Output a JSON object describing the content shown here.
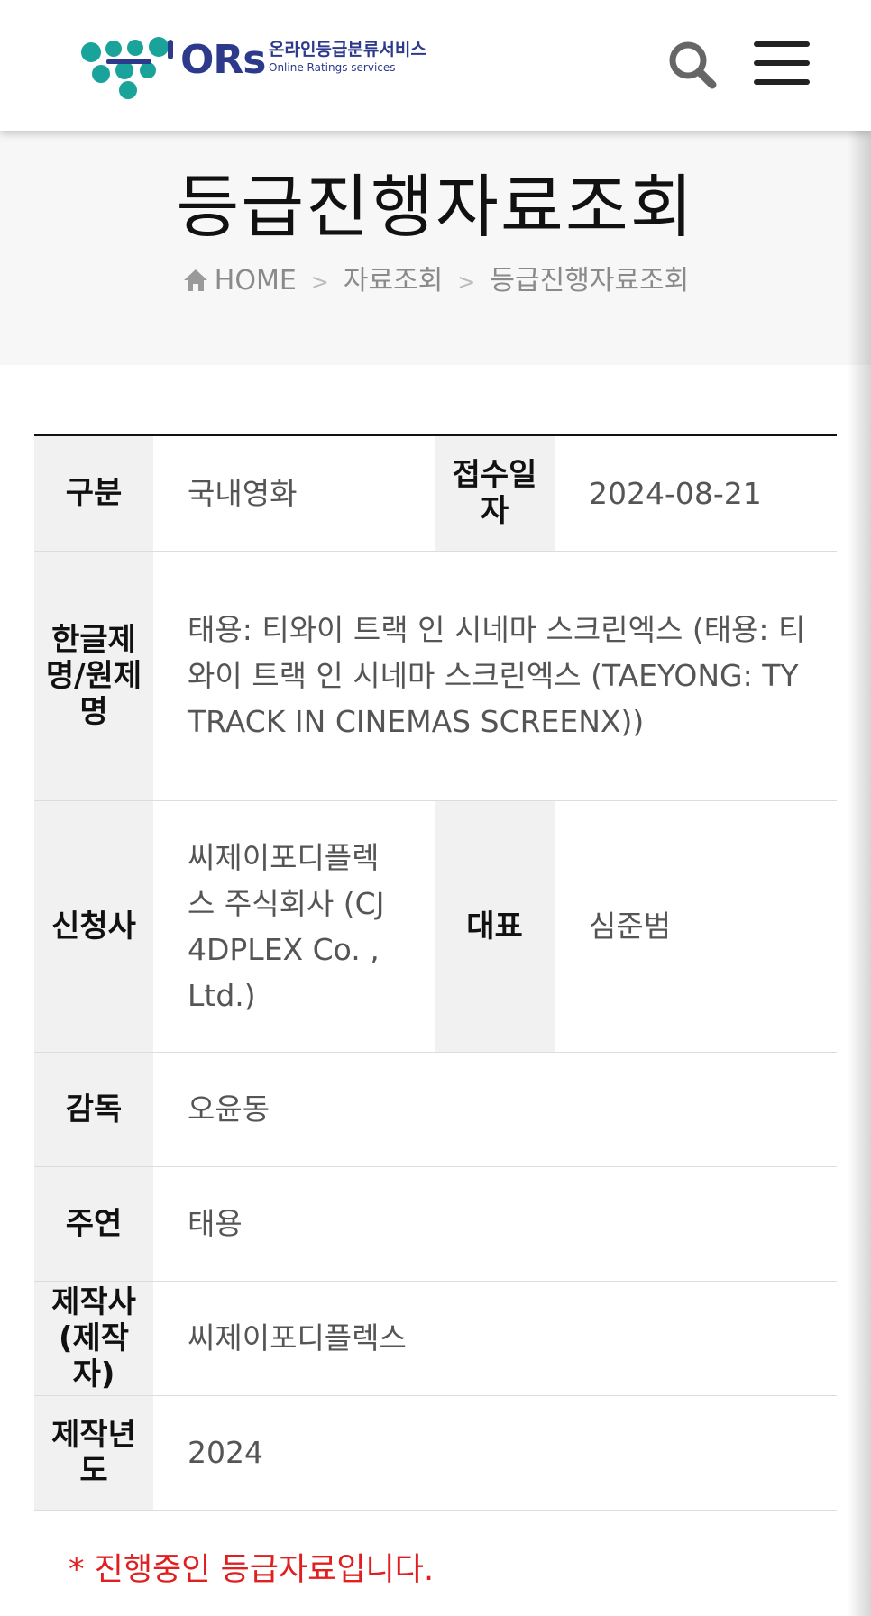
{
  "header": {
    "logo": {
      "brand": "ORs",
      "name_ko": "온라인등급분류서비스",
      "name_en": "Online Ratings services"
    },
    "icons": {
      "search": "search-icon",
      "menu": "hamburger-menu-icon"
    }
  },
  "title_band": {
    "title": "등급진행자료조회",
    "breadcrumb": [
      "HOME",
      "자료조회",
      "등급진행자료조회"
    ]
  },
  "table": {
    "rows": [
      {
        "label": "구분",
        "value": "국내영화",
        "label2": "접수일자",
        "value2": "2024-08-21"
      },
      {
        "label": "한글제명/원제명",
        "value": "태용: 티와이 트랙 인 시네마 스크린엑스 (태용: 티와이 트랙 인 시네마 스크린엑스 (TAEYONG: TY TRACK IN CINEMAS SCREENX))"
      },
      {
        "label": "신청사",
        "value": "씨제이포디플렉스 주식회사 (CJ 4DPLEX Co. , Ltd.)",
        "label2": "대표",
        "value2": "심준범"
      },
      {
        "label": "감독",
        "value": "오윤동"
      },
      {
        "label": "주연",
        "value": "태용"
      },
      {
        "label": "제작사(제작자)",
        "value": "씨제이포디플렉스"
      },
      {
        "label": "제작년도",
        "value": "2024"
      }
    ]
  },
  "notice": "* 진행중인 등급자료입니다.",
  "colors": {
    "brand_navy": "#2d3a8c",
    "brand_teal": "#1aa39a",
    "notice_red": "#e02020",
    "header_cell_bg": "#f1f1f1"
  }
}
